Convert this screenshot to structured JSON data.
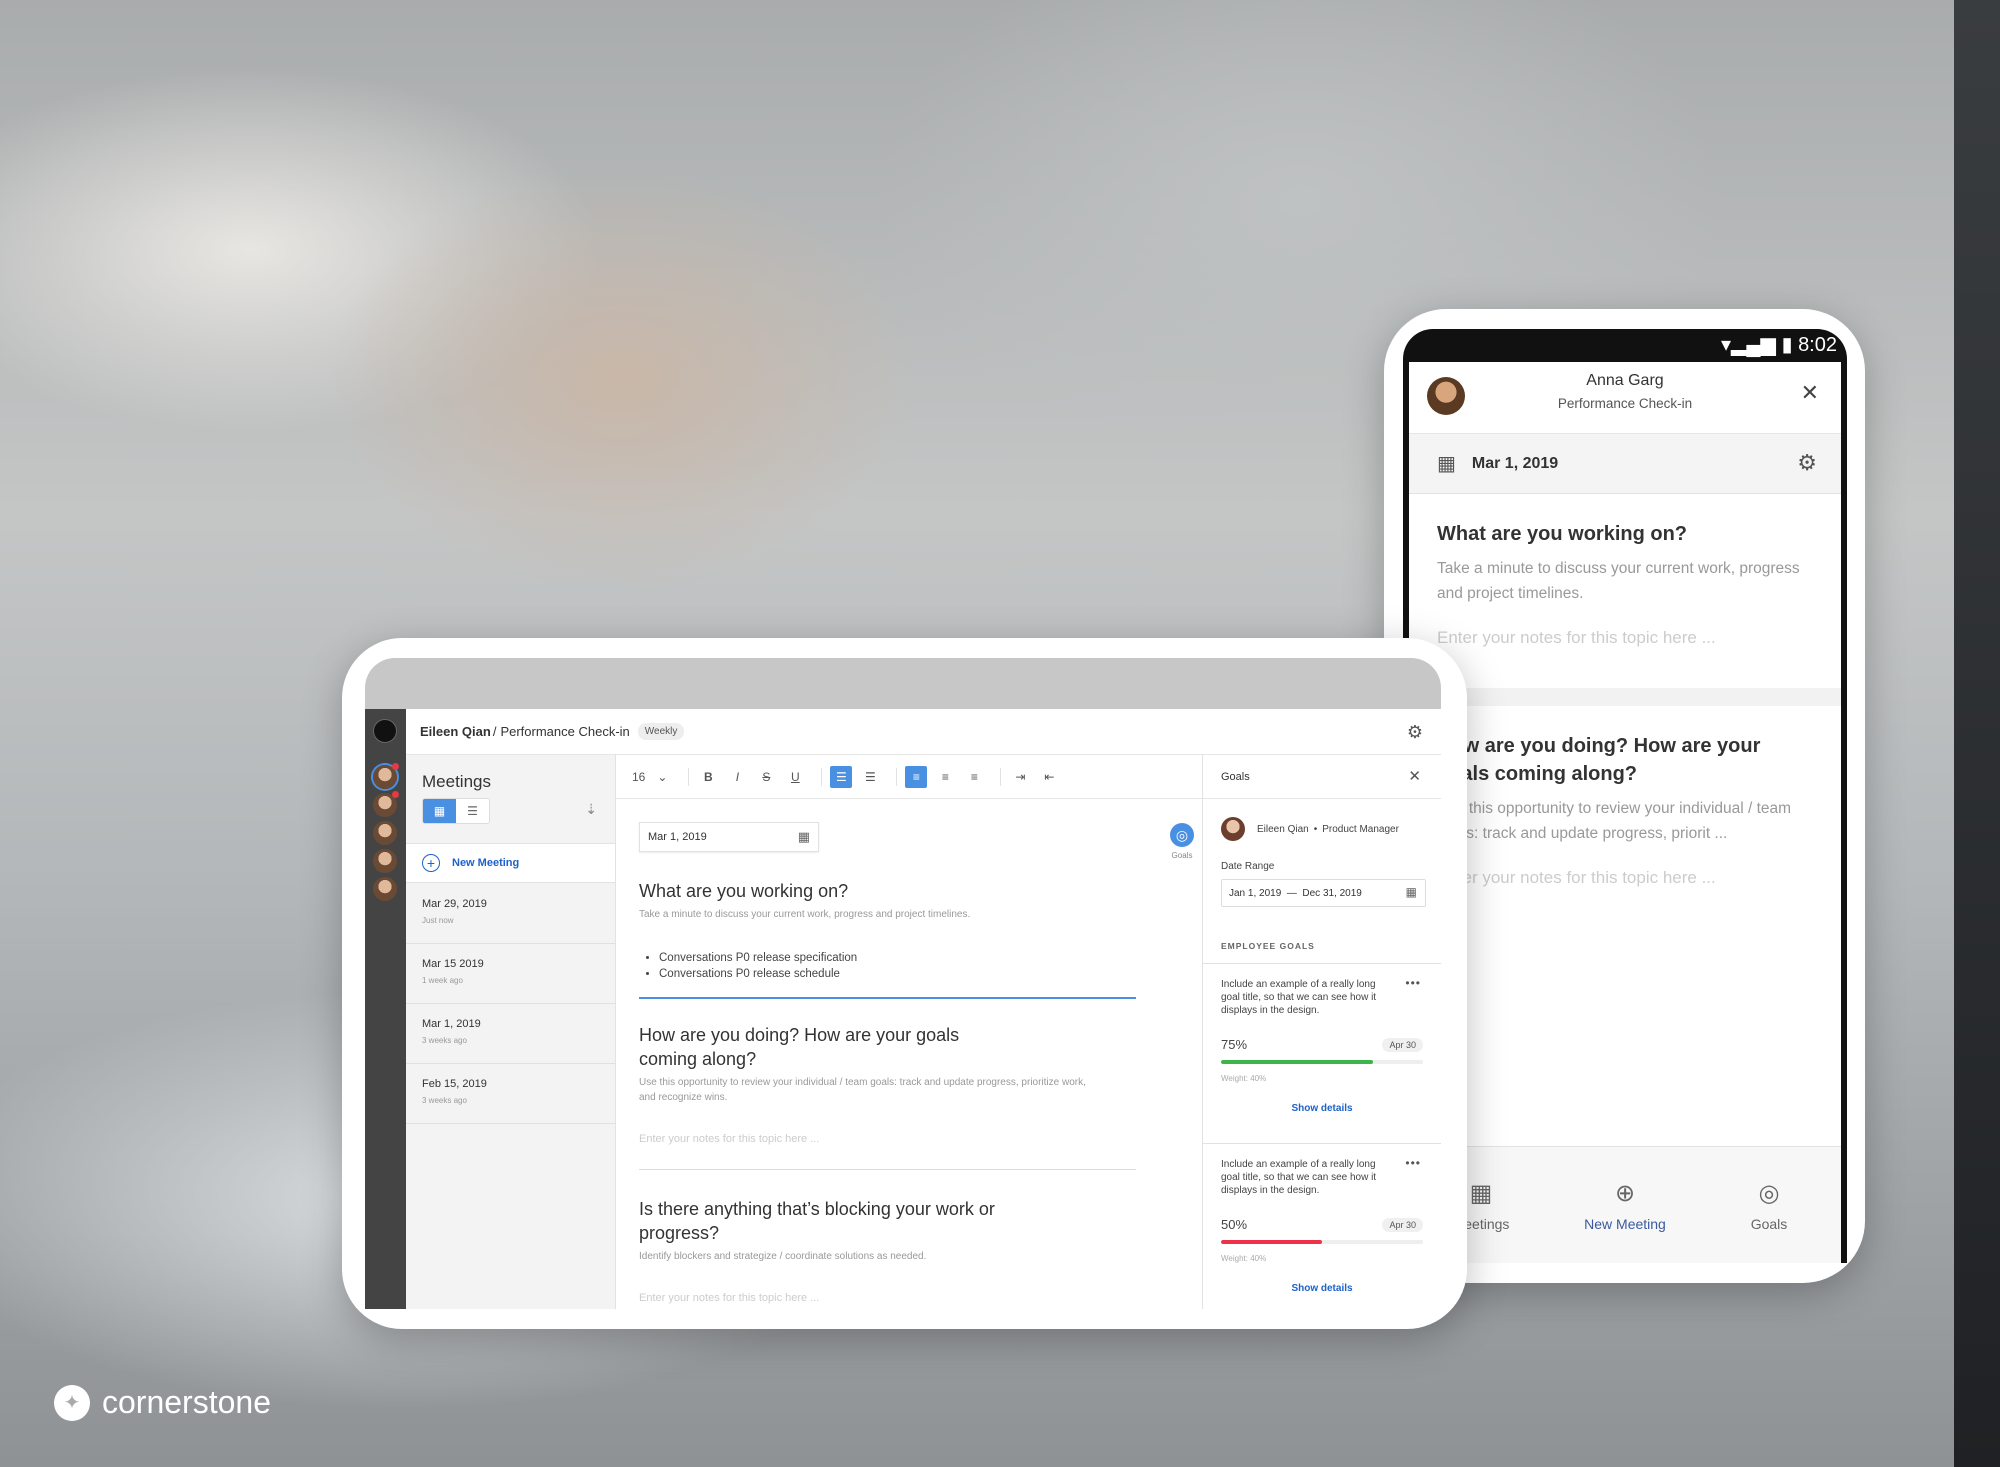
{
  "brand": {
    "name": "cornerstone"
  },
  "laptop": {
    "header": {
      "person": "Eileen Qian",
      "sep": "/",
      "meeting": "Performance Check-in",
      "badge": "Weekly"
    },
    "meetings": {
      "title": "Meetings",
      "new_meeting": "New Meeting",
      "items": [
        {
          "date": "Mar 29, 2019",
          "ago": "Just now"
        },
        {
          "date": "Mar 15 2019",
          "ago": "1 week ago"
        },
        {
          "date": "Mar 1, 2019",
          "ago": "3 weeks ago"
        },
        {
          "date": "Feb 15, 2019",
          "ago": "3 weeks ago"
        }
      ]
    },
    "toolbar": {
      "font_size": "16"
    },
    "editor": {
      "date": "Mar 1, 2019",
      "goals_label": "Goals",
      "topics": [
        {
          "title": "What are you working on?",
          "desc": "Take a minute to discuss your current work, progress and project timelines.",
          "bullets": [
            "Conversations P0 release specification",
            "Conversations P0 release schedule"
          ]
        },
        {
          "title": "How are you doing? How are your goals coming along?",
          "desc": "Use this opportunity to review your individual / team goals: track and update progress, prioritize work, and recognize wins.",
          "placeholder": "Enter your notes for this topic here ..."
        },
        {
          "title": "Is there anything that’s blocking your work or progress?",
          "desc": "Identify blockers and strategize / coordinate solutions as needed.",
          "placeholder": "Enter your notes for this topic here ..."
        }
      ]
    },
    "goals": {
      "title": "Goals",
      "person": "Eileen Qian",
      "role": "Product Manager",
      "date_range_label": "Date Range",
      "date_range": "Jan 1, 2019  —  Dec 31, 2019",
      "section": "EMPLOYEE GOALS",
      "items": [
        {
          "title": "Include an example of a really long goal title, so that we can see how it displays in the design.",
          "percent": "75%",
          "progress": 75,
          "due": "Apr 30",
          "weight": "Weight: 40%",
          "link": "Show details",
          "color": "#3bb54a"
        },
        {
          "title": "Include an example of a really long goal title, so that we can see how it displays in the design.",
          "percent": "50%",
          "progress": 50,
          "due": "Apr 30",
          "weight": "Weight: 40%",
          "link": "Show details",
          "color": "#f0304a"
        }
      ]
    }
  },
  "phone": {
    "time": "8:02",
    "name": "Anna Garg",
    "subtitle": "Performance Check-in",
    "date": "Mar 1, 2019",
    "topics": [
      {
        "title": "What are you working on?",
        "desc": "Take a minute to discuss your current work, progress and project timelines.",
        "placeholder": "Enter your notes for this topic here ..."
      },
      {
        "title": "How are you doing? How are your goals coming along?",
        "desc": "Use this opportunity to review your individual / team goals: track and update progress, priorit ...",
        "placeholder": "Enter your notes for this topic here ..."
      }
    ],
    "nav": [
      "Meetings",
      "New Meeting",
      "Goals"
    ]
  }
}
